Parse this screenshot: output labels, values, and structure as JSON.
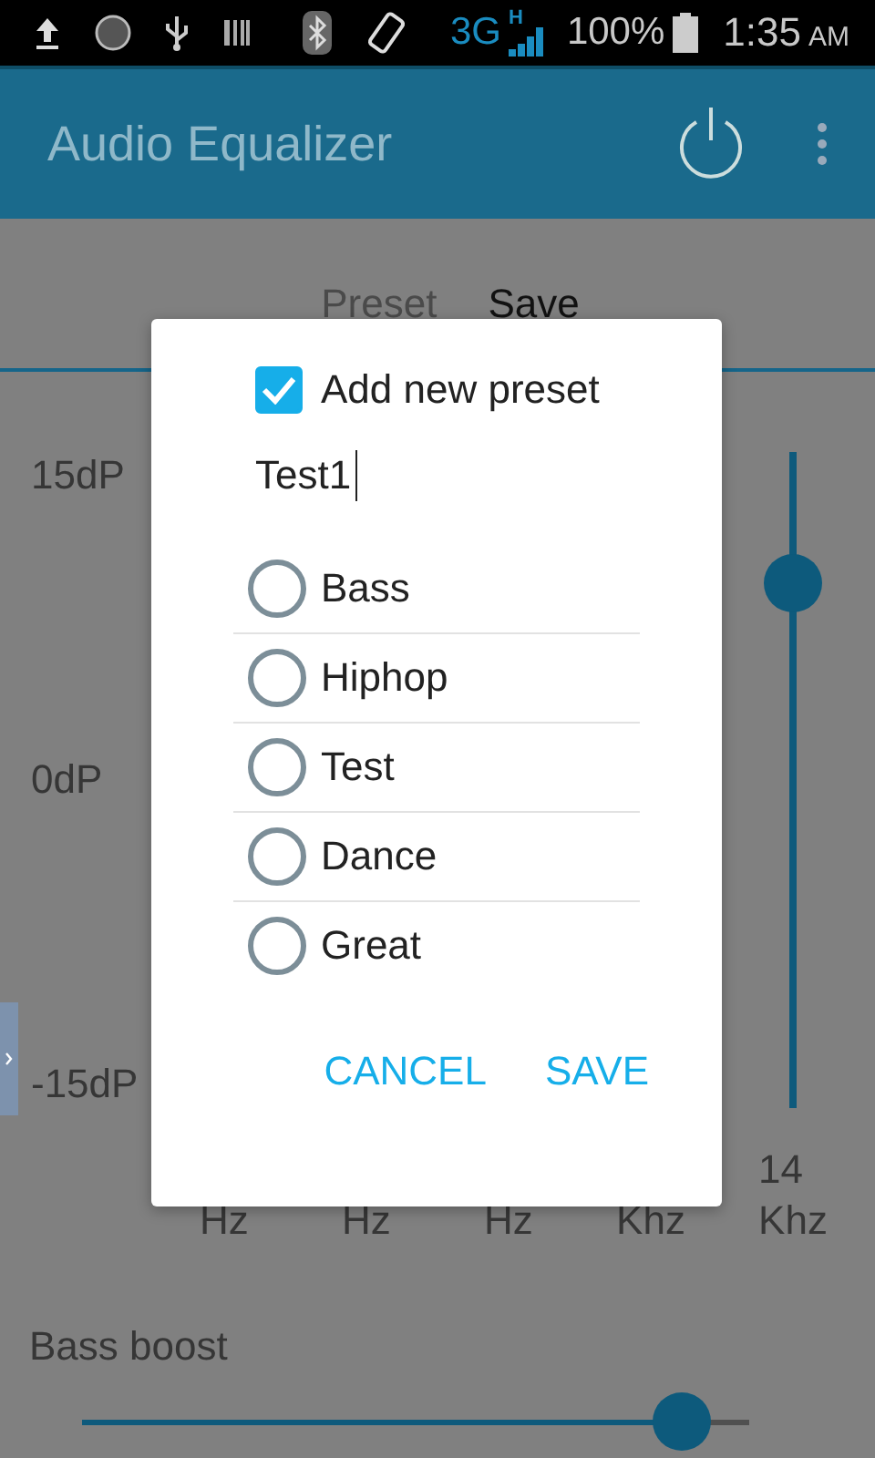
{
  "status_bar": {
    "network": "3G",
    "network_sub": "H",
    "battery": "100%",
    "time": "1:35",
    "period": "AM"
  },
  "app_bar": {
    "title": "Audio Equalizer"
  },
  "tabs": [
    {
      "label": "Preset",
      "selected": false
    },
    {
      "label": "Save",
      "selected": true
    }
  ],
  "equalizer": {
    "scale": [
      "15dP",
      "0dP",
      "-15dP"
    ],
    "bands": [
      {
        "label": "Hz"
      },
      {
        "label": "Hz"
      },
      {
        "label": "Hz"
      },
      {
        "label": "Khz"
      },
      {
        "label": "14 Khz",
        "level": 0.8
      }
    ]
  },
  "bass_boost": {
    "label": "Bass boost",
    "level": 0.9
  },
  "dialog": {
    "checkbox": {
      "label": "Add new preset",
      "checked": true
    },
    "name_field": {
      "value": "Test1"
    },
    "presets": [
      {
        "label": "Bass",
        "selected": false
      },
      {
        "label": "Hiphop",
        "selected": false
      },
      {
        "label": "Test",
        "selected": false
      },
      {
        "label": "Dance",
        "selected": false
      },
      {
        "label": "Great",
        "selected": false
      }
    ],
    "buttons": [
      "CANCEL",
      "SAVE"
    ]
  }
}
